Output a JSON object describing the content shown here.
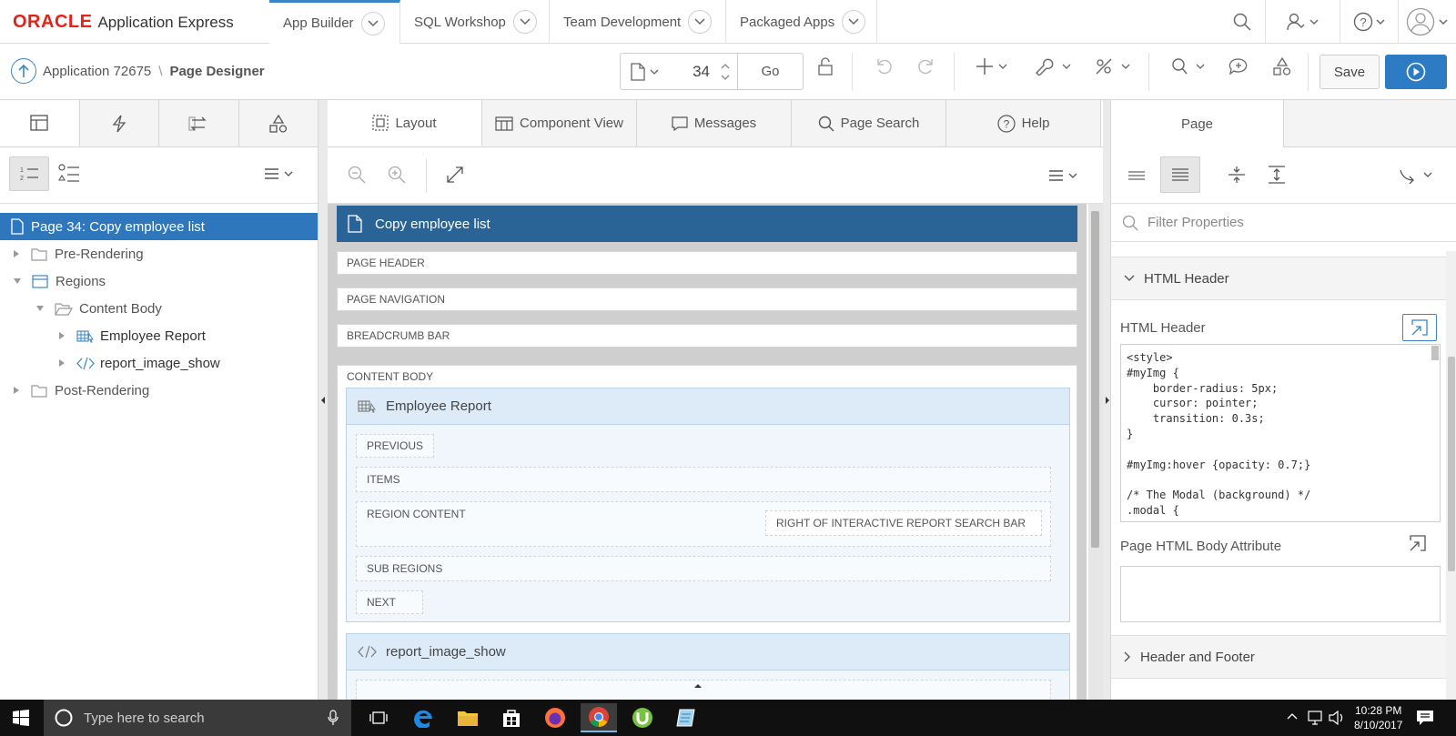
{
  "brand": {
    "oracle": "ORACLE",
    "product": "Application Express"
  },
  "main_tabs": [
    {
      "label": "App Builder",
      "active": true
    },
    {
      "label": "SQL Workshop"
    },
    {
      "label": "Team Development"
    },
    {
      "label": "Packaged Apps"
    }
  ],
  "breadcrumb": {
    "app": "Application 72675",
    "page": "Page Designer"
  },
  "page_selector": {
    "value": "34",
    "go": "Go"
  },
  "toolbar": {
    "save": "Save"
  },
  "left_tree": {
    "page": "Page 34: Copy employee list",
    "pre_rendering": "Pre-Rendering",
    "regions": "Regions",
    "content_body": "Content Body",
    "employee_report": "Employee Report",
    "report_image_show": "report_image_show",
    "post_rendering": "Post-Rendering"
  },
  "center_tabs": [
    {
      "label": "Layout",
      "icon": "layout-icon",
      "active": true
    },
    {
      "label": "Component View",
      "icon": "component-view-icon"
    },
    {
      "label": "Messages",
      "icon": "messages-icon"
    },
    {
      "label": "Page Search",
      "icon": "search-icon"
    },
    {
      "label": "Help",
      "icon": "help-icon"
    }
  ],
  "layout": {
    "page_title": "Copy employee list",
    "page_header": "Page Header",
    "page_navigation": "Page Navigation",
    "breadcrumb_bar": "Breadcrumb Bar",
    "content_body": "CONTENT BODY",
    "region1": {
      "title": "Employee Report",
      "previous": "PREVIOUS",
      "items": "ITEMS",
      "region_content": "REGION CONTENT",
      "right_of_ir": "RIGHT OF INTERACTIVE REPORT SEARCH BAR",
      "sub_regions": "SUB REGIONS",
      "next": "NEXT"
    },
    "region2": {
      "title": "report_image_show"
    }
  },
  "right_panel": {
    "tab": "Page",
    "filter_placeholder": "Filter Properties",
    "section_html_header": "HTML Header",
    "html_header_label": "HTML Header",
    "html_header_code": "<style>\n#myImg {\n    border-radius: 5px;\n    cursor: pointer;\n    transition: 0.3s;\n}\n\n#myImg:hover {opacity: 0.7;}\n\n/* The Modal (background) */\n.modal {",
    "body_attr_label": "Page HTML Body Attribute",
    "section_header_footer": "Header and Footer"
  },
  "taskbar": {
    "search_placeholder": "Type here to search",
    "time": "10:28 PM",
    "date": "8/10/2017"
  },
  "colors": {
    "accent": "#2e77bc",
    "page_bar": "#2a6496",
    "run_button": "#2d7bc3",
    "oracle_red": "#e2231a"
  }
}
